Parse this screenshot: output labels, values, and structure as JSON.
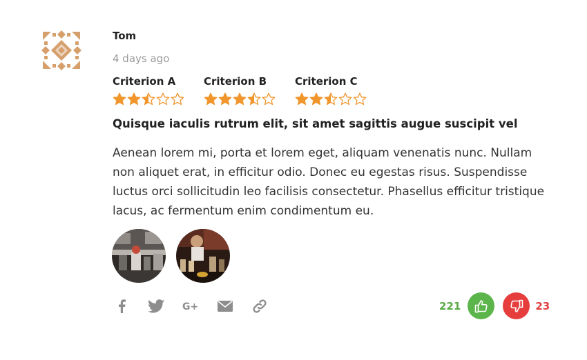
{
  "review": {
    "author": "Tom",
    "date": "4 days ago",
    "criteria": [
      {
        "label": "Criterion A",
        "rating": 2.5,
        "max": 5
      },
      {
        "label": "Criterion B",
        "rating": 3.5,
        "max": 5
      },
      {
        "label": "Criterion C",
        "rating": 2.5,
        "max": 5
      }
    ],
    "title": "Quisque iaculis rutrum elit, sit amet sagittis augue suscipit vel",
    "body": "Aenean lorem mi, porta et lorem eget, aliquam venenatis nunc. Nullam non aliquet erat, in efficitur odio. Donec eu egestas risus. Suspendisse luctus orci sollicitudin leo facilisis consectetur. Phasellus efficitur tristique lacus, ac fermentum enim condimentum eu.",
    "photos": [
      {
        "icon": "kitchen-photo"
      },
      {
        "icon": "bar-photo"
      }
    ]
  },
  "share": {
    "icons": [
      "facebook-icon",
      "twitter-icon",
      "google-plus-icon",
      "email-icon",
      "link-icon"
    ]
  },
  "votes": {
    "up_count": "221",
    "down_count": "23"
  },
  "colors": {
    "star": "#f0962c",
    "avatar": "#d6a06d",
    "vote_up": "#5cb54a",
    "vote_down": "#e53e3d"
  }
}
